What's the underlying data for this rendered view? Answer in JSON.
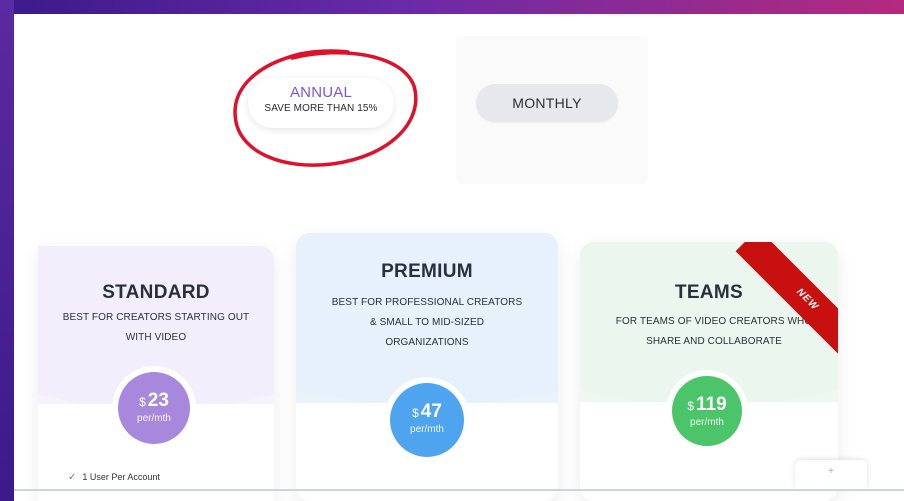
{
  "billing": {
    "annual": {
      "label": "ANNUAL",
      "note": "SAVE MORE THAN 15%"
    },
    "monthly": {
      "label": "MONTHLY"
    }
  },
  "plans": [
    {
      "name": "STANDARD",
      "description_lines": [
        "BEST FOR CREATORS STARTING OUT",
        "WITH VIDEO"
      ],
      "currency": "$",
      "price": "23",
      "period": "per/mth",
      "color": "#a888dd",
      "feature_preview": "1 User Per Account"
    },
    {
      "name": "PREMIUM",
      "description_lines": [
        "BEST FOR PROFESSIONAL CREATORS",
        "& SMALL TO MID-SIZED",
        "ORGANIZATIONS"
      ],
      "currency": "$",
      "price": "47",
      "period": "per/mth",
      "color": "#4fa4f0"
    },
    {
      "name": "TEAMS",
      "description_lines": [
        "FOR TEAMS OF VIDEO CREATORS WHO",
        "SHARE AND COLLABORATE"
      ],
      "currency": "$",
      "price": "119",
      "period": "per/mth",
      "color": "#4cc46a",
      "badge": "NEW"
    }
  ],
  "colors": {
    "accent_purple": "#7a52e6",
    "annotation_red": "#e0102a",
    "ribbon_red": "#c91010"
  }
}
